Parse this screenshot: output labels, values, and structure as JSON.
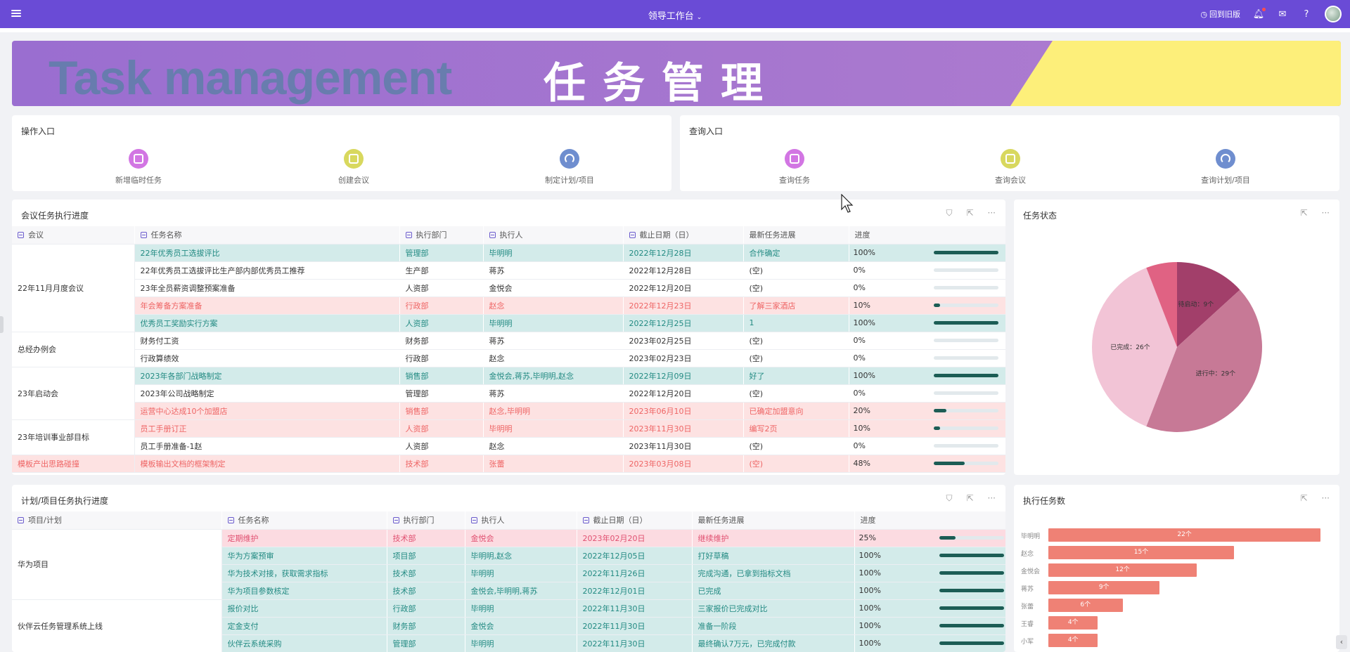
{
  "topbar": {
    "title": "领导工作台",
    "return_old": "回到旧版",
    "colors": {
      "bg": "#6a4bd6"
    }
  },
  "banner": {
    "english": "Task management",
    "chinese": "任务管理"
  },
  "operation_entry": {
    "title": "操作入口",
    "items": [
      {
        "label": "新增临时任务",
        "icon": "shield-check-icon",
        "color": "#d276e3"
      },
      {
        "label": "创建会议",
        "icon": "calendar-check-icon",
        "color": "#d8d85e"
      },
      {
        "label": "制定计划/项目",
        "icon": "signal-icon",
        "color": "#6f8ecf"
      }
    ]
  },
  "query_entry": {
    "title": "查询入口",
    "items": [
      {
        "label": "查询任务",
        "icon": "shield-check-icon",
        "color": "#d276e3"
      },
      {
        "label": "查询会议",
        "icon": "calendar-check-icon",
        "color": "#d8d85e"
      },
      {
        "label": "查询计划/项目",
        "icon": "signal-icon",
        "color": "#6f8ecf"
      }
    ]
  },
  "meeting_table": {
    "title": "会议任务执行进度",
    "columns": [
      "会议",
      "任务名称",
      "执行部门",
      "执行人",
      "截止日期（日）",
      "最新任务进展",
      "进度"
    ],
    "groups": [
      {
        "name": "22年11月月度会议",
        "rows": [
          {
            "style": "teal",
            "task": "22年优秀员工选拔评比",
            "dept": "管理部",
            "owner": "毕明明",
            "due": "2022年12月28日",
            "progress_note": "合作确定",
            "pct_label": "100%",
            "pct": 1.0
          },
          {
            "style": "",
            "task": "22年优秀员工选拔评比生产部内部优秀员工推荐",
            "dept": "生产部",
            "owner": "蒋苏",
            "due": "2022年12月28日",
            "progress_note": "(空)",
            "pct_label": "0%",
            "pct": 0
          },
          {
            "style": "",
            "task": "23年全员薪资调整预案准备",
            "dept": "人资部",
            "owner": "金悦会",
            "due": "2022年12月20日",
            "progress_note": "(空)",
            "pct_label": "0%",
            "pct": 0
          },
          {
            "style": "pink",
            "task": "年会筹备方案准备",
            "dept": "行政部",
            "owner": "赵念",
            "due": "2022年12月23日",
            "progress_note": "了解三家酒店",
            "pct_label": "10%",
            "pct": 0.1
          },
          {
            "style": "teal",
            "task": "优秀员工奖励实行方案",
            "dept": "人资部",
            "owner": "毕明明",
            "due": "2022年12月25日",
            "progress_note": "1",
            "pct_label": "100%",
            "pct": 1.0
          }
        ]
      },
      {
        "name": "总经办例会",
        "rows": [
          {
            "style": "",
            "task": "财务付工资",
            "dept": "财务部",
            "owner": "蒋苏",
            "due": "2023年02月25日",
            "progress_note": "(空)",
            "pct_label": "0%",
            "pct": 0
          },
          {
            "style": "",
            "task": "行政算绩效",
            "dept": "行政部",
            "owner": "赵念",
            "due": "2023年02月23日",
            "progress_note": "(空)",
            "pct_label": "0%",
            "pct": 0
          }
        ]
      },
      {
        "name": "23年启动会",
        "rows": [
          {
            "style": "teal",
            "task": "2023年各部门战略制定",
            "dept": "销售部",
            "owner": "金悦会,蒋苏,毕明明,赵念",
            "due": "2022年12月09日",
            "progress_note": "好了",
            "pct_label": "100%",
            "pct": 1.0
          },
          {
            "style": "",
            "task": "2023年公司战略制定",
            "dept": "管理部",
            "owner": "蒋苏",
            "due": "2022年12月20日",
            "progress_note": "(空)",
            "pct_label": "0%",
            "pct": 0
          },
          {
            "style": "pink",
            "task": "运营中心达成10个加盟店",
            "dept": "销售部",
            "owner": "赵念,毕明明",
            "due": "2023年06月10日",
            "progress_note": "已确定加盟意向",
            "pct_label": "20%",
            "pct": 0.2
          }
        ]
      },
      {
        "name": "23年培训事业部目标",
        "rows": [
          {
            "style": "pink",
            "task": "员工手册订正",
            "dept": "人资部",
            "owner": "毕明明",
            "due": "2023年11月30日",
            "progress_note": "编写2页",
            "pct_label": "10%",
            "pct": 0.1
          },
          {
            "style": "",
            "task": "员工手册准备-1赵",
            "dept": "人资部",
            "owner": "赵念",
            "due": "2023年11月30日",
            "progress_note": "(空)",
            "pct_label": "0%",
            "pct": 0
          }
        ]
      },
      {
        "name": "模板产出思路碰撞",
        "pink_group": true,
        "rows": [
          {
            "style": "pink",
            "task": "模板输出文档的框架制定",
            "dept": "技术部",
            "owner": "张蕾",
            "due": "2023年03月08日",
            "progress_note": "(空)",
            "pct_label": "48%",
            "pct": 0.48
          }
        ]
      }
    ]
  },
  "status_chart": {
    "title": "任务状态"
  },
  "chart_data": [
    {
      "type": "pie",
      "title": "任务状态",
      "labels": [
        "待启动",
        "进行中",
        "已完成",
        ""
      ],
      "values": [
        9,
        29,
        26,
        4
      ],
      "label_text": [
        "待启动：9个",
        "进行中：29个",
        "已完成：26个",
        ""
      ],
      "colors": [
        "#a23f6a",
        "#c77996",
        "#f2c4d6",
        "#e06283"
      ]
    },
    {
      "type": "bar",
      "title": "执行任务数",
      "orientation": "horizontal",
      "categories": [
        "毕明明",
        "赵念",
        "金悦会",
        "蒋苏",
        "张蕾",
        "王睿",
        "小军"
      ],
      "values": [
        22,
        15,
        12,
        9,
        6,
        4,
        4
      ],
      "value_labels": [
        "22个",
        "15个",
        "12个",
        "9个",
        "6个",
        "4个",
        "4个"
      ],
      "xlim": [
        0,
        25
      ]
    }
  ],
  "plan_table": {
    "title": "计划/项目任务执行进度",
    "columns": [
      "项目/计划",
      "任务名称",
      "执行部门",
      "执行人",
      "截止日期（日）",
      "最新任务进展",
      "进度"
    ],
    "groups": [
      {
        "name": "华为项目",
        "rows": [
          {
            "style": "rose",
            "task": "定期维护",
            "dept": "技术部",
            "owner": "金悦会",
            "due": "2023年02月20日",
            "progress_note": "继续维护",
            "pct_label": "25%",
            "pct": 0.25
          },
          {
            "style": "teal",
            "task": "华为方案预审",
            "dept": "项目部",
            "owner": "毕明明,赵念",
            "due": "2022年12月05日",
            "progress_note": "打好草稿",
            "pct_label": "100%",
            "pct": 1.0
          },
          {
            "style": "teal",
            "task": "华为技术对接，获取需求指标",
            "dept": "技术部",
            "owner": "毕明明",
            "due": "2022年11月26日",
            "progress_note": "完成沟通，已拿到指标文档",
            "pct_label": "100%",
            "pct": 1.0
          },
          {
            "style": "teal",
            "task": "华为项目参数核定",
            "dept": "技术部",
            "owner": "金悦会,毕明明,蒋苏",
            "due": "2022年12月01日",
            "progress_note": "已完成",
            "pct_label": "100%",
            "pct": 1.0
          }
        ]
      },
      {
        "name": "伙伴云任务管理系统上线",
        "rows": [
          {
            "style": "teal",
            "task": "报价对比",
            "dept": "行政部",
            "owner": "毕明明",
            "due": "2022年11月30日",
            "progress_note": "三家报价已完成对比",
            "pct_label": "100%",
            "pct": 1.0
          },
          {
            "style": "teal",
            "task": "定金支付",
            "dept": "财务部",
            "owner": "金悦会",
            "due": "2022年11月30日",
            "progress_note": "准备一阶段",
            "pct_label": "100%",
            "pct": 1.0
          },
          {
            "style": "teal",
            "task": "伙伴云系统采购",
            "dept": "管理部",
            "owner": "毕明明",
            "due": "2022年11月30日",
            "progress_note": "最终确认7万元，已完成付款",
            "pct_label": "100%",
            "pct": 1.0
          }
        ]
      }
    ]
  },
  "exec_chart": {
    "title": "执行任务数"
  }
}
